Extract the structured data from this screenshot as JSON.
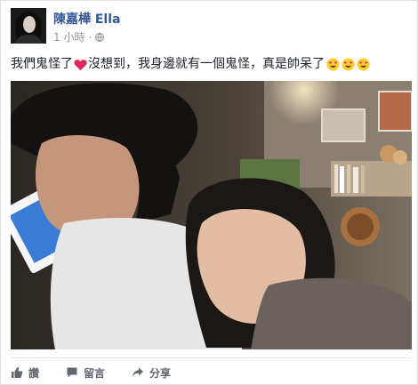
{
  "post": {
    "author": "陳嘉樺 Ella",
    "timestamp": "1 小時",
    "separator": "·",
    "privacy_icon": "globe-icon",
    "text_before_heart": "我們鬼怪了",
    "text_after_heart": "沒想到，我身邊就有一個鬼怪，真是帥呆了",
    "heart_icon": "red-heart-emoji",
    "trailing_emoji": [
      "heart-eyes-emoji",
      "heart-eyes-emoji",
      "heart-eyes-emoji"
    ],
    "photo_description_icon": "photo"
  },
  "actions": {
    "like_label": "讚",
    "comment_label": "留言",
    "share_label": "分享"
  },
  "colors": {
    "author": "#365899",
    "meta": "#90949c",
    "action_text": "#616770",
    "heart": "#e0245e",
    "emoji_face": "#ffcc33"
  }
}
